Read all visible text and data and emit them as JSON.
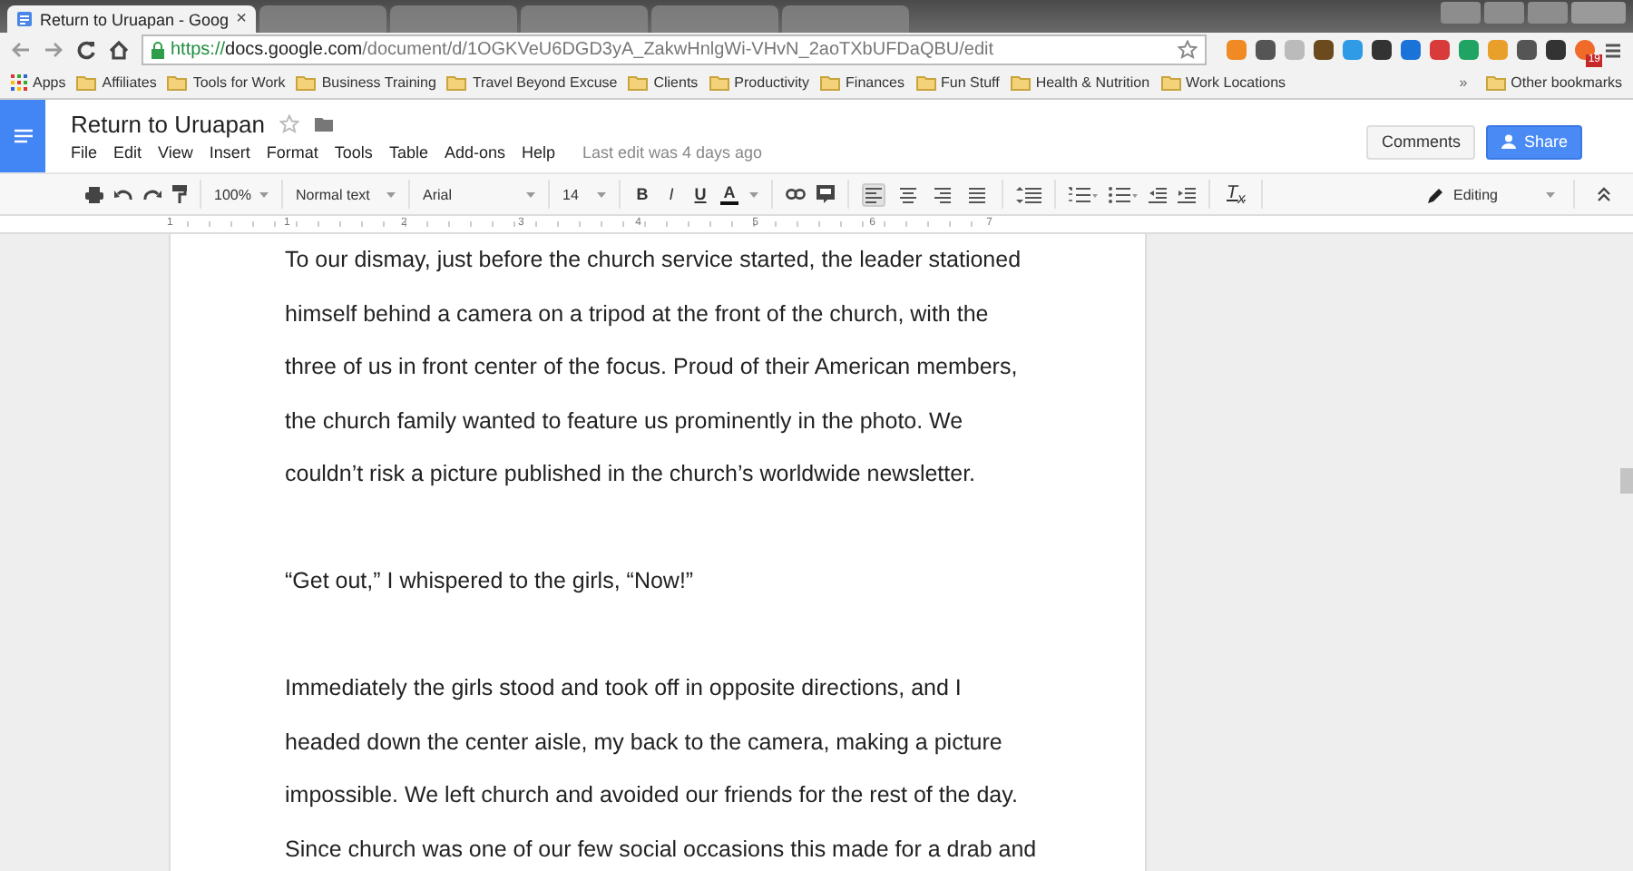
{
  "browser": {
    "tabs": [
      {
        "title": "Return to Uruapan - Goog",
        "close": "×",
        "selected": true
      },
      {
        "selected": false
      },
      {
        "selected": false
      },
      {
        "selected": false
      },
      {
        "selected": false
      },
      {
        "selected": false
      }
    ],
    "url": {
      "scheme": "https://",
      "host": "docs.google.com",
      "path": "/document/d/1OGKVeU6DGD3yA_ZakwHnlgWi-VHvN_2aoTXbUFDaQBU/edit"
    },
    "extensions": [
      {
        "color": "#f08a24"
      },
      {
        "color": "#555555"
      },
      {
        "color": "#bbbbbb"
      },
      {
        "color": "#6b4a1e"
      },
      {
        "color": "#2f9be6"
      },
      {
        "color": "#333333"
      },
      {
        "color": "#1a73d9"
      },
      {
        "color": "#d93a3a"
      },
      {
        "color": "#1fa463"
      },
      {
        "color": "#e8a02a"
      },
      {
        "color": "#555555"
      },
      {
        "color": "#333333"
      },
      {
        "color": "#f06a2a",
        "badge": "19"
      }
    ],
    "bookmarks": [
      "Affiliates",
      "Tools for Work",
      "Business Training",
      "Travel Beyond Excuse",
      "Clients",
      "Productivity",
      "Finances",
      "Fun Stuff",
      "Health & Nutrition",
      "Work Locations"
    ],
    "apps_label": "Apps",
    "overflow": "»",
    "other_bookmarks": "Other bookmarks"
  },
  "document": {
    "title": "Return to Uruapan",
    "starred": false,
    "menus": [
      "File",
      "Edit",
      "View",
      "Insert",
      "Format",
      "Tools",
      "Table",
      "Add-ons",
      "Help"
    ],
    "last_edit": "Last edit was 4 days ago",
    "comments_button": "Comments",
    "share_button": "Share"
  },
  "toolbar": {
    "zoom": "100%",
    "style": "Normal text",
    "font": "Arial",
    "size": "14",
    "format_buttons": [
      {
        "label": "B",
        "kind": "bold"
      },
      {
        "label": "I",
        "kind": "italic"
      },
      {
        "label": "U",
        "kind": "underline"
      },
      {
        "label": "A",
        "kind": "color"
      }
    ],
    "alignments": [
      {
        "kind": "left",
        "selected": true
      },
      {
        "kind": "center",
        "selected": false
      },
      {
        "kind": "right",
        "selected": false
      },
      {
        "kind": "justify",
        "selected": false
      }
    ],
    "clear_formatting": "T$_{x}$",
    "mode": "Editing"
  },
  "ruler": {
    "labels": [
      "1",
      "1",
      "2",
      "3",
      "4",
      "5",
      "6",
      "7"
    ]
  },
  "paragraphs": [
    {
      "lines": [
        "To our dismay, just before the church service started, the leader stationed",
        "himself behind a camera on a tripod at the front of the church, with the",
        "three of us in front center of the focus. Proud of their American members,",
        "the church family wanted to feature us prominently in the photo. We",
        "couldn’t risk a picture published in the church’s worldwide newsletter."
      ]
    },
    {
      "lines": [
        "“Get out,” I whispered to the girls, “Now!”"
      ]
    },
    {
      "lines": [
        "Immediately the girls stood and took off in opposite directions, and I",
        "headed down the center aisle, my back to the camera, making a picture",
        "impossible.  We left church and avoided our friends for the rest of the day.",
        "Since church was one of our few social occasions this made for a drab and"
      ]
    }
  ]
}
